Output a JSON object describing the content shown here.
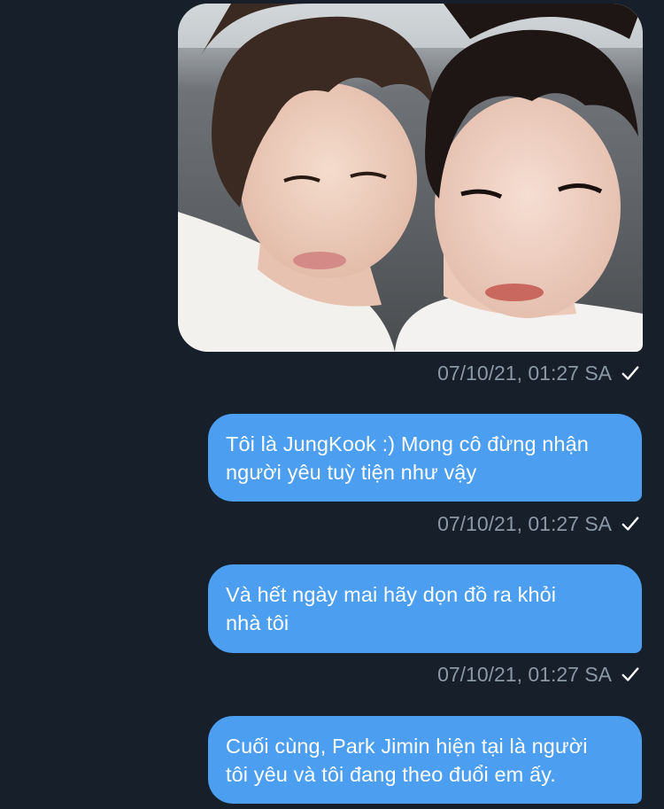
{
  "messages": [
    {
      "type": "image",
      "image_alt": "selfie of two young men",
      "time": "07/10/21, 01:27 SA",
      "status_icon": "check-icon"
    },
    {
      "type": "text",
      "text": "Tôi là JungKook :) Mong cô đừng nhận\nngười yêu tuỳ tiện như vậy",
      "time": "07/10/21, 01:27 SA",
      "status_icon": "check-icon"
    },
    {
      "type": "text",
      "text": "Và hết ngày mai hãy dọn đồ ra khỏi\nnhà tôi",
      "time": "07/10/21, 01:27 SA",
      "status_icon": "check-icon"
    },
    {
      "type": "text",
      "text": "Cuối cùng, Park Jimin hiện tại là người\ntôi yêu và tôi đang theo đuổi em ấy."
    }
  ],
  "colors": {
    "background": "#161f2a",
    "bubble": "#4b9ef0",
    "meta_text": "#8b98a5",
    "bubble_text": "#ffffff"
  }
}
